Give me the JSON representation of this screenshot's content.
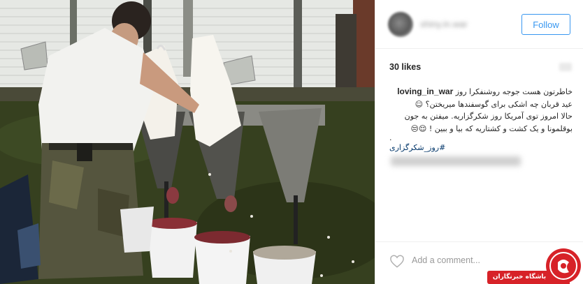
{
  "header": {
    "username": "shiny.in.war",
    "follow_label": "Follow"
  },
  "post": {
    "likes": "30 likes",
    "author": "loving_in_war",
    "caption_lines": [
      "خاطرتون هست جوجه روشنفکرا روز",
      "عید قربان چه اشکی برای گوسفندها میریختن؟ ☺",
      "حالا امروز توی آمریکا روز شکرگزاریه. میفتن به جون",
      "بوقلمونا و یک کشت و کشتاریه که بیا و ببین ! 😌😒"
    ],
    "caption_dot": ".",
    "hashtag": "#روز_شکرگزاری"
  },
  "footer": {
    "add_comment_placeholder": "Add a comment..."
  },
  "watermark": {
    "text": "باشگاه خبرنگاران"
  },
  "colors": {
    "accent": "#3897f0",
    "hashtag": "#003569",
    "watermark_red": "#d72228"
  }
}
